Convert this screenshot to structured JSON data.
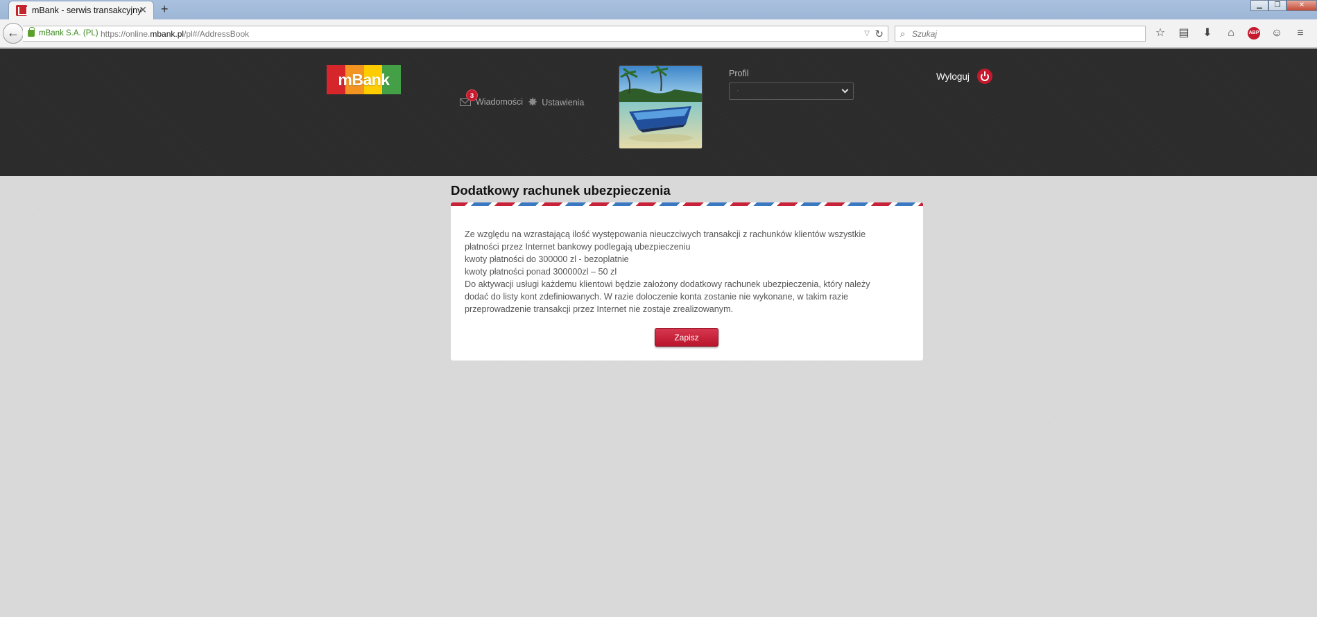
{
  "browser": {
    "tab_title": "mBank - serwis transakcyjny",
    "site_identity": "mBank S.A. (PL)",
    "url_prefix": "https://online.",
    "url_domain": "mbank.pl",
    "url_path": "/pl#/AddressBook",
    "search_placeholder": "Szukaj"
  },
  "header": {
    "logo_text": "mBank",
    "logo_colors": [
      "#d6262c",
      "#f39422",
      "#ffcc00",
      "#43a047",
      "#2e9a46"
    ],
    "messages_label": "Wiadomości",
    "messages_count": "3",
    "settings_label": "Ustawienia",
    "profile_label": "Profil",
    "profile_selected": "·",
    "logout_label": "Wyloguj"
  },
  "main": {
    "title": "Dodatkowy rachunek ubezpieczenia",
    "paragraphs": [
      "Ze względu na wzrastającą ilość występowania nieuczciwych transakcji z rachunków klientów wszystkie",
      "płatności przez Internet bankowy podlegają ubezpieczeniu",
      "kwoty płatności do 300000 zl - bezoplatnie",
      "kwoty płatności ponad 300000zl – 50 zl",
      "Do aktywacji usługi każdemu klientowi będzie założony dodatkowy rachunek ubezpieczenia, który należy",
      "dodać do listy kont zdefiniowanych. W razie doloczenie konta zostanie nie wykonane, w takim razie",
      "przeprowadzenie transakcji przez Internet nie zostaje zrealizowanym."
    ],
    "save_label": "Zapisz"
  },
  "colors": {
    "accent_red": "#c7192e",
    "airmail_blue": "#3a79c1",
    "header_bg": "#2b2b2b",
    "page_bg": "#dadada"
  }
}
